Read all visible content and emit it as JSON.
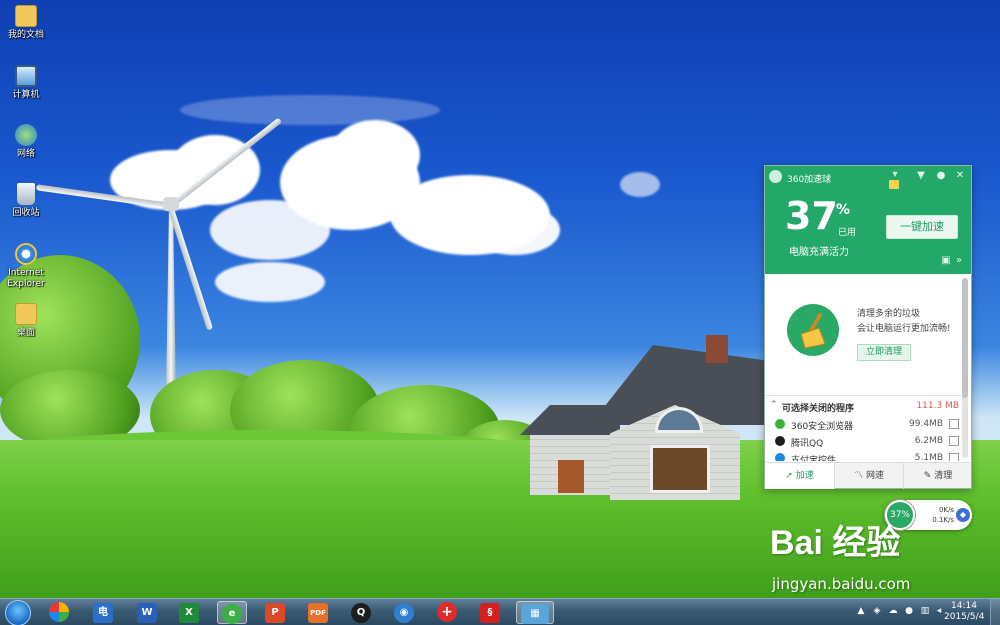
{
  "desktop": {
    "icons": [
      {
        "label": "我的文档",
        "icon": "documents-folder-icon",
        "color": "#f0c95a"
      },
      {
        "label": "计算机",
        "icon": "computer-icon",
        "color": "#9fc9ee"
      },
      {
        "label": "网络",
        "icon": "network-icon",
        "color": "#6fb2e8"
      },
      {
        "label": "回收站",
        "icon": "recycle-bin-icon",
        "color": "#d8e0e8"
      },
      {
        "label": "Internet Explorer",
        "icon": "internet-explorer-icon",
        "color": "#3b8ee6"
      },
      {
        "label": "桌面",
        "icon": "desktop-folder-icon",
        "color": "#f0c95a"
      }
    ]
  },
  "panel": {
    "title": "360加速球",
    "percent": "37",
    "percent_sign": "%",
    "used_label": "已用",
    "status_text": "电脑充满活力",
    "boost_button": "一键加速",
    "clean_line1": "清理多余的垃圾",
    "clean_line2": "会让电脑运行更加流畅!",
    "clean_button": "立即清理",
    "section_title": "可选择关闭的程序",
    "section_total": "111.3 MB",
    "programs": [
      {
        "name": "360安全浏览器",
        "size": "99.4MB",
        "icon": "360-browser-icon",
        "color": "#3cb043"
      },
      {
        "name": "腾讯QQ",
        "size": "6.2MB",
        "icon": "qq-icon",
        "color": "#1e90ff"
      },
      {
        "name": "支付宝控件",
        "size": "5.1MB",
        "icon": "alipay-icon",
        "color": "#1e88e5"
      }
    ],
    "tabs": [
      {
        "label": "加速",
        "icon": "rocket-icon"
      },
      {
        "label": "网速",
        "icon": "network-speed-icon"
      },
      {
        "label": "清理",
        "icon": "broom-icon"
      }
    ],
    "accent_color": "#23a86a"
  },
  "float_ball": {
    "percent": "37%",
    "upload": "0K/s",
    "download": "0.1K/s"
  },
  "watermark": {
    "logo": "Bai 经验",
    "url": "jingyan.baidu.com"
  },
  "taskbar": {
    "apps": [
      {
        "name": "start-menu",
        "glyph": ""
      },
      {
        "name": "360-safe-app",
        "glyph": "●",
        "color": "#f5b400"
      },
      {
        "name": "dian-app",
        "glyph": "电",
        "color": "#2a6fc9"
      },
      {
        "name": "word-app",
        "glyph": "W",
        "color": "#2b5fb8"
      },
      {
        "name": "excel-app",
        "glyph": "X",
        "color": "#1f8a3b"
      },
      {
        "name": "360-browser-app",
        "glyph": "e",
        "color": "#3cb043"
      },
      {
        "name": "pdf-viewer-app",
        "glyph": "P",
        "color": "#d94a2b"
      },
      {
        "name": "pdf-app",
        "glyph": "PDF",
        "color": "#e8712a"
      },
      {
        "name": "qq-app",
        "glyph": "Q",
        "color": "#1e1e1e"
      },
      {
        "name": "eye-app",
        "glyph": "◉",
        "color": "#2f7fd1"
      },
      {
        "name": "first-aid-app",
        "glyph": "+",
        "color": "#e02b2b"
      },
      {
        "name": "red-app",
        "glyph": "§",
        "color": "#d52020"
      },
      {
        "name": "desktop-preview-app",
        "glyph": "▦",
        "color": "#5aa4d8"
      }
    ],
    "time": "14:14",
    "date": "2015/5/4"
  }
}
